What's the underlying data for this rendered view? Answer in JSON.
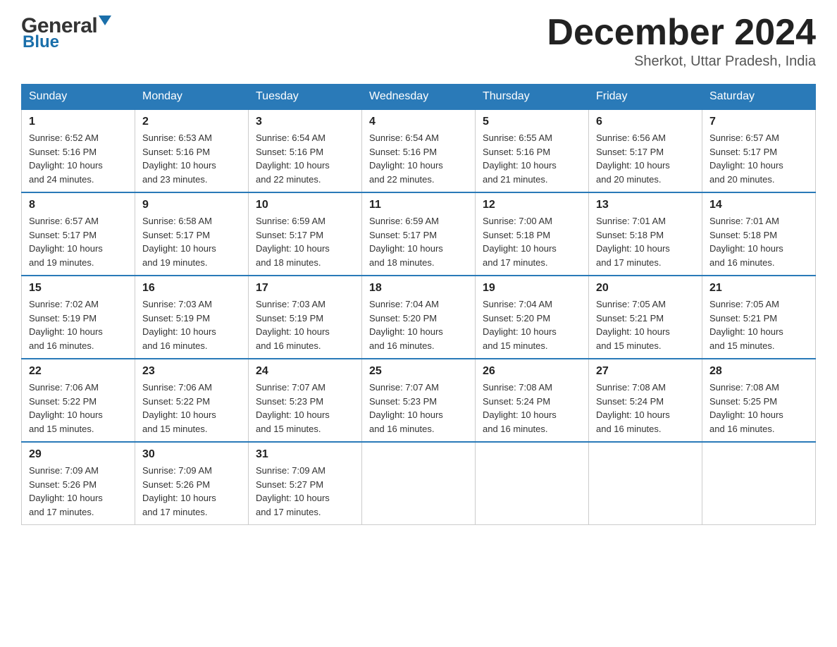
{
  "header": {
    "logo": {
      "name_black": "General",
      "arrow": "▶",
      "name_blue": "Blue"
    },
    "title": "December 2024",
    "location": "Sherkot, Uttar Pradesh, India"
  },
  "calendar": {
    "days_of_week": [
      "Sunday",
      "Monday",
      "Tuesday",
      "Wednesday",
      "Thursday",
      "Friday",
      "Saturday"
    ],
    "weeks": [
      [
        {
          "day": "1",
          "sunrise": "6:52 AM",
          "sunset": "5:16 PM",
          "daylight": "10 hours and 24 minutes."
        },
        {
          "day": "2",
          "sunrise": "6:53 AM",
          "sunset": "5:16 PM",
          "daylight": "10 hours and 23 minutes."
        },
        {
          "day": "3",
          "sunrise": "6:54 AM",
          "sunset": "5:16 PM",
          "daylight": "10 hours and 22 minutes."
        },
        {
          "day": "4",
          "sunrise": "6:54 AM",
          "sunset": "5:16 PM",
          "daylight": "10 hours and 22 minutes."
        },
        {
          "day": "5",
          "sunrise": "6:55 AM",
          "sunset": "5:16 PM",
          "daylight": "10 hours and 21 minutes."
        },
        {
          "day": "6",
          "sunrise": "6:56 AM",
          "sunset": "5:17 PM",
          "daylight": "10 hours and 20 minutes."
        },
        {
          "day": "7",
          "sunrise": "6:57 AM",
          "sunset": "5:17 PM",
          "daylight": "10 hours and 20 minutes."
        }
      ],
      [
        {
          "day": "8",
          "sunrise": "6:57 AM",
          "sunset": "5:17 PM",
          "daylight": "10 hours and 19 minutes."
        },
        {
          "day": "9",
          "sunrise": "6:58 AM",
          "sunset": "5:17 PM",
          "daylight": "10 hours and 19 minutes."
        },
        {
          "day": "10",
          "sunrise": "6:59 AM",
          "sunset": "5:17 PM",
          "daylight": "10 hours and 18 minutes."
        },
        {
          "day": "11",
          "sunrise": "6:59 AM",
          "sunset": "5:17 PM",
          "daylight": "10 hours and 18 minutes."
        },
        {
          "day": "12",
          "sunrise": "7:00 AM",
          "sunset": "5:18 PM",
          "daylight": "10 hours and 17 minutes."
        },
        {
          "day": "13",
          "sunrise": "7:01 AM",
          "sunset": "5:18 PM",
          "daylight": "10 hours and 17 minutes."
        },
        {
          "day": "14",
          "sunrise": "7:01 AM",
          "sunset": "5:18 PM",
          "daylight": "10 hours and 16 minutes."
        }
      ],
      [
        {
          "day": "15",
          "sunrise": "7:02 AM",
          "sunset": "5:19 PM",
          "daylight": "10 hours and 16 minutes."
        },
        {
          "day": "16",
          "sunrise": "7:03 AM",
          "sunset": "5:19 PM",
          "daylight": "10 hours and 16 minutes."
        },
        {
          "day": "17",
          "sunrise": "7:03 AM",
          "sunset": "5:19 PM",
          "daylight": "10 hours and 16 minutes."
        },
        {
          "day": "18",
          "sunrise": "7:04 AM",
          "sunset": "5:20 PM",
          "daylight": "10 hours and 16 minutes."
        },
        {
          "day": "19",
          "sunrise": "7:04 AM",
          "sunset": "5:20 PM",
          "daylight": "10 hours and 15 minutes."
        },
        {
          "day": "20",
          "sunrise": "7:05 AM",
          "sunset": "5:21 PM",
          "daylight": "10 hours and 15 minutes."
        },
        {
          "day": "21",
          "sunrise": "7:05 AM",
          "sunset": "5:21 PM",
          "daylight": "10 hours and 15 minutes."
        }
      ],
      [
        {
          "day": "22",
          "sunrise": "7:06 AM",
          "sunset": "5:22 PM",
          "daylight": "10 hours and 15 minutes."
        },
        {
          "day": "23",
          "sunrise": "7:06 AM",
          "sunset": "5:22 PM",
          "daylight": "10 hours and 15 minutes."
        },
        {
          "day": "24",
          "sunrise": "7:07 AM",
          "sunset": "5:23 PM",
          "daylight": "10 hours and 15 minutes."
        },
        {
          "day": "25",
          "sunrise": "7:07 AM",
          "sunset": "5:23 PM",
          "daylight": "10 hours and 16 minutes."
        },
        {
          "day": "26",
          "sunrise": "7:08 AM",
          "sunset": "5:24 PM",
          "daylight": "10 hours and 16 minutes."
        },
        {
          "day": "27",
          "sunrise": "7:08 AM",
          "sunset": "5:24 PM",
          "daylight": "10 hours and 16 minutes."
        },
        {
          "day": "28",
          "sunrise": "7:08 AM",
          "sunset": "5:25 PM",
          "daylight": "10 hours and 16 minutes."
        }
      ],
      [
        {
          "day": "29",
          "sunrise": "7:09 AM",
          "sunset": "5:26 PM",
          "daylight": "10 hours and 17 minutes."
        },
        {
          "day": "30",
          "sunrise": "7:09 AM",
          "sunset": "5:26 PM",
          "daylight": "10 hours and 17 minutes."
        },
        {
          "day": "31",
          "sunrise": "7:09 AM",
          "sunset": "5:27 PM",
          "daylight": "10 hours and 17 minutes."
        },
        null,
        null,
        null,
        null
      ]
    ],
    "labels": {
      "sunrise": "Sunrise:",
      "sunset": "Sunset:",
      "daylight": "Daylight:"
    }
  }
}
